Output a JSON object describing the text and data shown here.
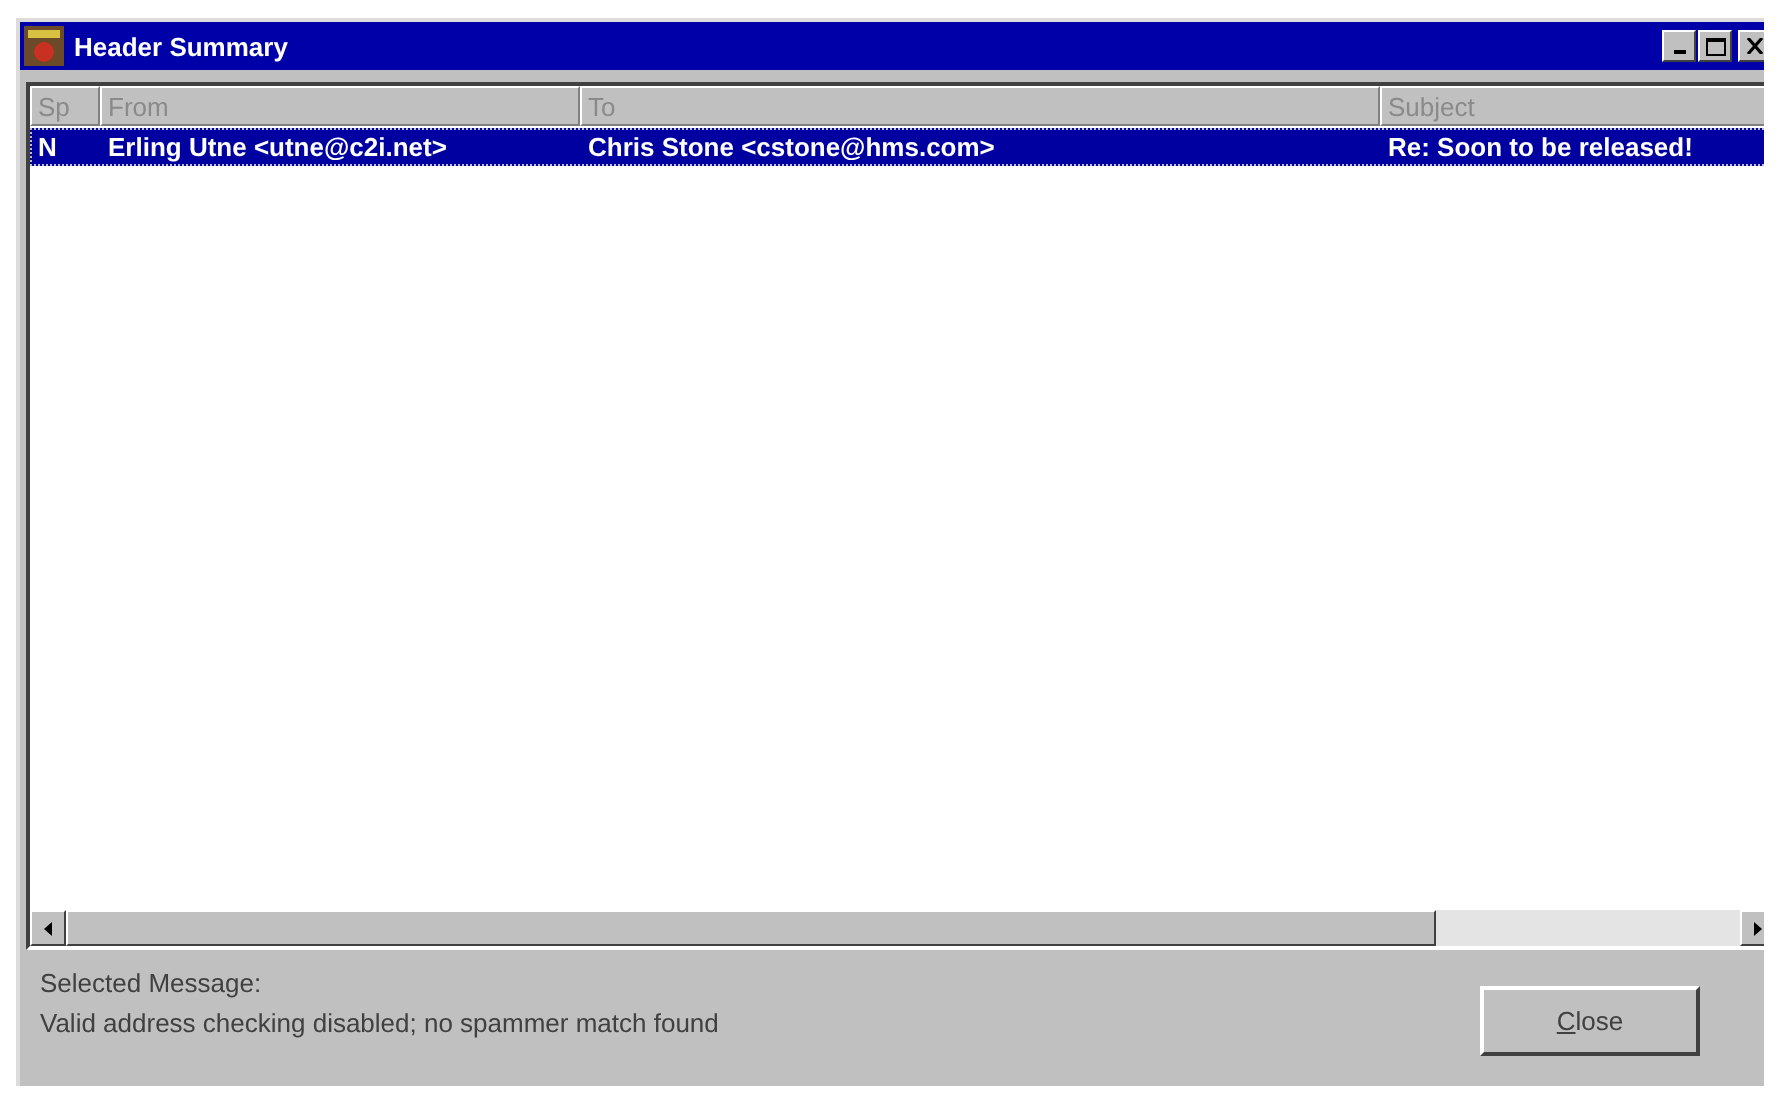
{
  "window": {
    "title": "Header Summary"
  },
  "table": {
    "columns": [
      "Sp",
      "From",
      "To",
      "Subject"
    ],
    "rows": [
      {
        "cells": [
          "N",
          "Erling Utne <utne@c2i.net>",
          "Chris Stone <cstone@hms.com>",
          "Re: Soon to be released!"
        ],
        "selected": true
      }
    ]
  },
  "status": {
    "label": "Selected Message:",
    "message": "Valid address checking disabled; no spammer match found"
  },
  "buttons": [
    {
      "label": "Close"
    }
  ]
}
